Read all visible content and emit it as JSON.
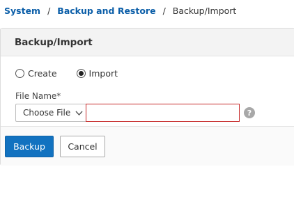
{
  "breadcrumb": {
    "items": [
      "System",
      "Backup and Restore"
    ],
    "current": "Backup/Import",
    "separator": "/"
  },
  "panel": {
    "title": "Backup/Import"
  },
  "mode": {
    "options": [
      "Create",
      "Import"
    ],
    "selected": "Import"
  },
  "file": {
    "label": "File Name*",
    "choose_button": "Choose File",
    "value": "",
    "help_glyph": "?"
  },
  "actions": {
    "primary": "Backup",
    "secondary": "Cancel"
  },
  "colors": {
    "accent": "#1272c0",
    "link": "#0b5ea8",
    "error_border": "#c62828"
  },
  "icons": [
    "chevron-down-icon",
    "help-icon"
  ]
}
